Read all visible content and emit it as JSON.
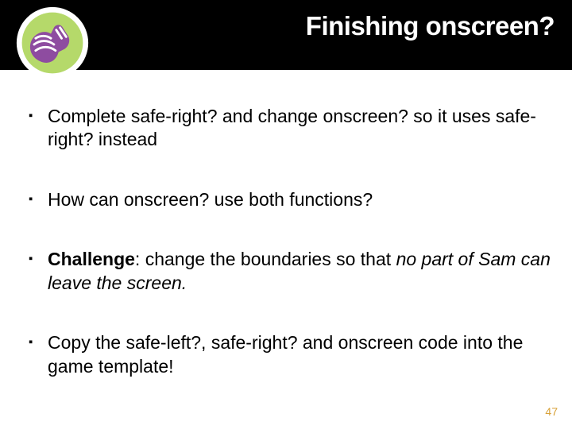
{
  "header": {
    "title": "Finishing onscreen?"
  },
  "bullets": {
    "b1": "Complete safe-right? and change onscreen? so it uses safe-right? instead",
    "b2": "How can onscreen? use both functions?",
    "b3_label": "Challenge",
    "b3_colon": ": change the boundaries so that ",
    "b3_ital": "no part of Sam can leave the screen.",
    "b4": "Copy the safe-left?, safe-right? and onscreen code into the game template!"
  },
  "page_number": "47"
}
